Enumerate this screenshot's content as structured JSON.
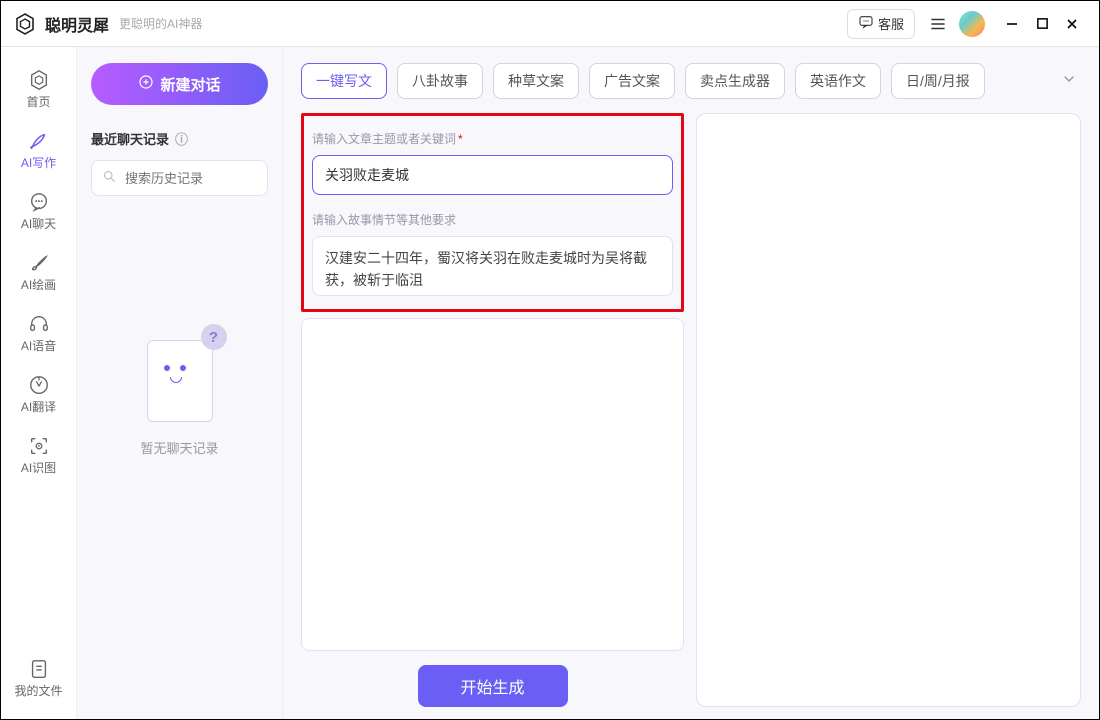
{
  "titlebar": {
    "brand": "聪明灵犀",
    "subtitle": "更聪明的AI神器",
    "support_label": "客服"
  },
  "nav": {
    "items": [
      {
        "label": "首页",
        "icon": "home-hex-icon"
      },
      {
        "label": "AI写作",
        "icon": "pen-icon"
      },
      {
        "label": "AI聊天",
        "icon": "chat-icon"
      },
      {
        "label": "AI绘画",
        "icon": "brush-icon"
      },
      {
        "label": "AI语音",
        "icon": "headset-icon"
      },
      {
        "label": "AI翻译",
        "icon": "translate-icon"
      },
      {
        "label": "AI识图",
        "icon": "vision-icon"
      }
    ],
    "bottom": {
      "label": "我的文件",
      "icon": "file-icon"
    },
    "active_index": 1
  },
  "history": {
    "new_chat_label": "新建对话",
    "section_title": "最近聊天记录",
    "search_placeholder": "搜索历史记录",
    "empty_text": "暂无聊天记录"
  },
  "tabs": {
    "items": [
      "一键写文",
      "八卦故事",
      "种草文案",
      "广告文案",
      "卖点生成器",
      "英语作文",
      "日/周/月报"
    ],
    "active_index": 0
  },
  "form": {
    "topic_label": "请输入文章主题或者关键词",
    "topic_value": "关羽败走麦城",
    "detail_label": "请输入故事情节等其他要求",
    "detail_value": "汉建安二十四年，蜀汉将关羽在败走麦城时为吴将截获，被斩于临沮",
    "generate_label": "开始生成"
  }
}
